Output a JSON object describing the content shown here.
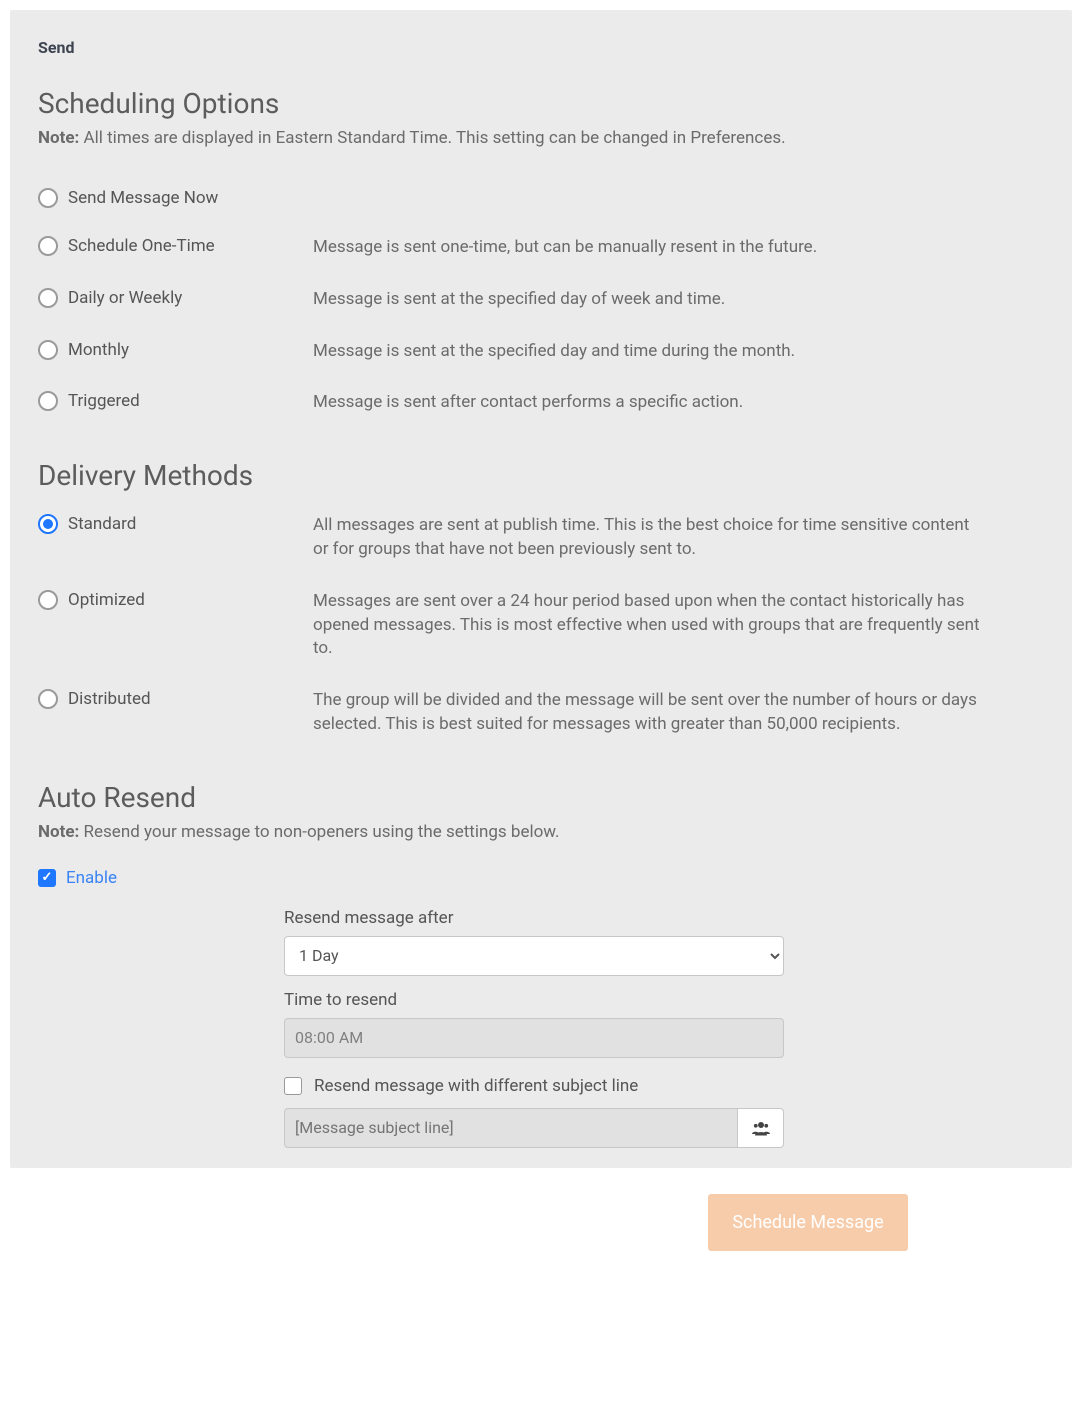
{
  "section_label": "Send",
  "scheduling": {
    "heading": "Scheduling Options",
    "note_prefix": "Note:",
    "note_text": " All times are displayed in Eastern Standard Time. This setting can be changed in Preferences.",
    "options": {
      "now": {
        "label": "Send Message Now",
        "desc": ""
      },
      "one_time": {
        "label": "Schedule One-Time",
        "desc": "Message is sent one-time, but can be manually resent in the future."
      },
      "daily": {
        "label": "Daily or Weekly",
        "desc": "Message is sent at the specified day of week and time."
      },
      "monthly": {
        "label": "Monthly",
        "desc": "Message is sent at the specified day and time during the month."
      },
      "triggered": {
        "label": "Triggered",
        "desc": "Message is sent after contact performs a specific action."
      }
    }
  },
  "delivery": {
    "heading": "Delivery Methods",
    "options": {
      "standard": {
        "label": "Standard",
        "desc": "All messages are sent at publish time. This is the best choice for time sensitive content or for groups that have not been previously sent to."
      },
      "optimized": {
        "label": "Optimized",
        "desc": "Messages are sent over a 24 hour period based upon when the contact historically has opened messages. This is most effective when used with groups that are frequently sent to."
      },
      "distributed": {
        "label": "Distributed",
        "desc": "The group will be divided and the message will be sent over the number of hours or days selected. This is best suited for messages with greater than 50,000 recipients."
      }
    }
  },
  "auto_resend": {
    "heading": "Auto Resend",
    "note_prefix": "Note:",
    "note_text": " Resend your message to non-openers using the settings below.",
    "enable_label": "Enable",
    "resend_after_label": "Resend message after",
    "resend_after_value": "1 Day",
    "time_label": "Time to resend",
    "time_value": "08:00 AM",
    "diff_subject_label": "Resend message with different subject line",
    "subject_placeholder": "[Message subject line]"
  },
  "footer_button": "Schedule Message"
}
